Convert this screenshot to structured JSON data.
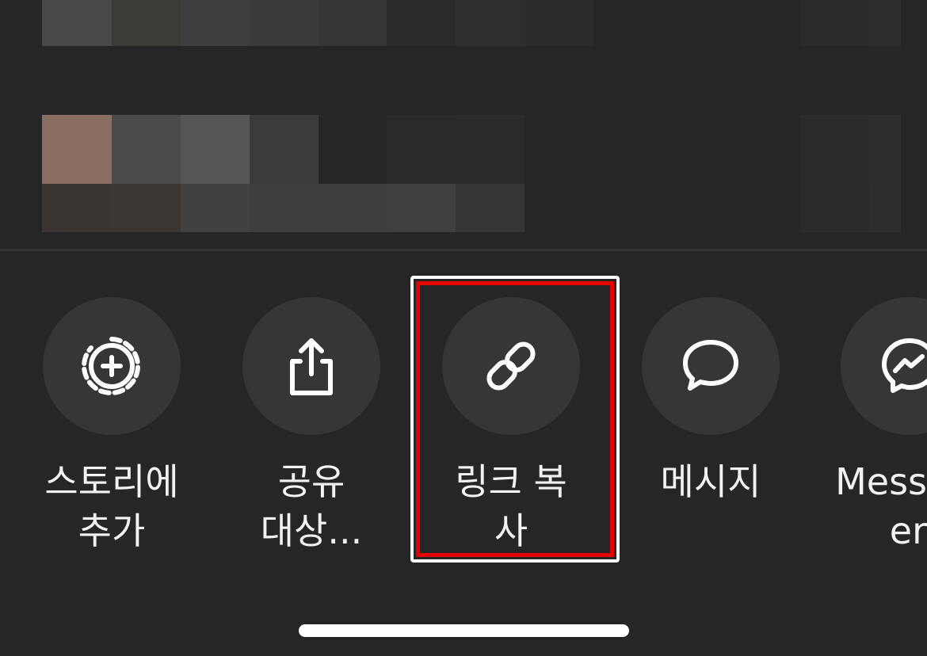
{
  "share_sheet": {
    "actions": [
      {
        "label": "스토리에\n추가",
        "icon": "add-to-story-icon"
      },
      {
        "label": "공유\n대상...",
        "icon": "share-upload-icon"
      },
      {
        "label": "링크 복사",
        "icon": "link-icon"
      },
      {
        "label": "메시지",
        "icon": "message-bubble-icon"
      },
      {
        "label": "Mess\ner",
        "icon": "messenger-icon"
      }
    ],
    "highlighted_action": "링크 복사"
  },
  "colors": {
    "background": "#262626",
    "circle": "#363636",
    "highlight_border": "#e60000",
    "text": "#f2f2f2"
  }
}
